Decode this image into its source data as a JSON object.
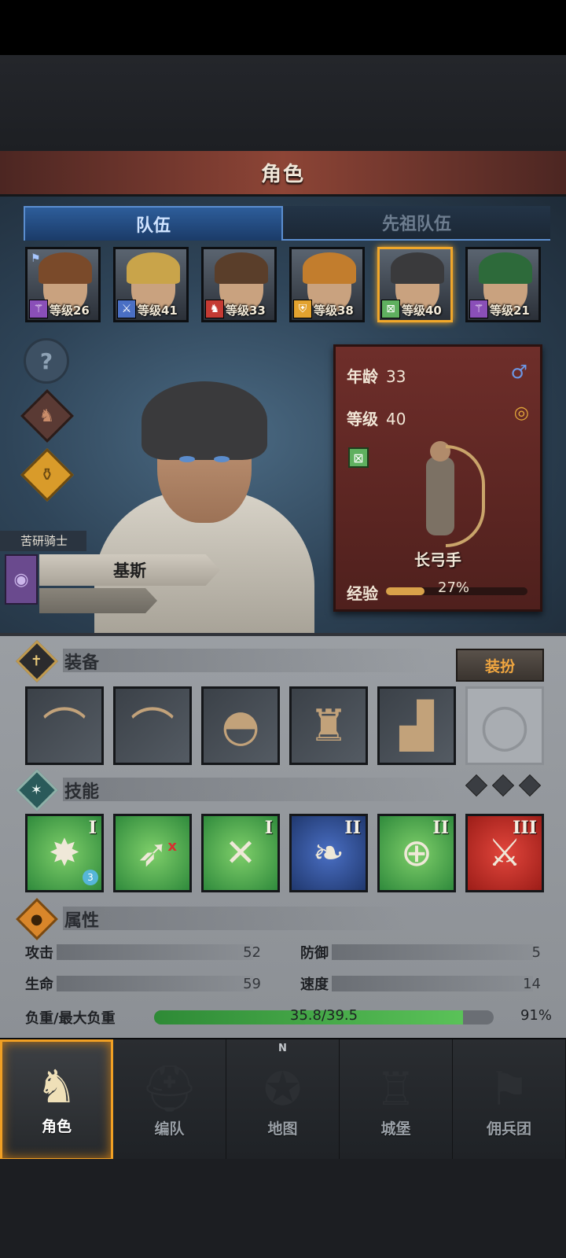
{
  "header": {
    "title": "角色"
  },
  "tabs": [
    {
      "label": "队伍",
      "active": true
    },
    {
      "label": "先祖队伍",
      "active": false
    }
  ],
  "party": [
    {
      "level": "等级26",
      "badge_icon": "staff-icon",
      "badge_color": "#8a4fb8",
      "hair_color": "#7a4a2a",
      "flag": true,
      "selected": false
    },
    {
      "level": "等级41",
      "badge_icon": "sword-icon",
      "badge_color": "#4a6fc4",
      "hair_color": "#c9a44a",
      "flag": false,
      "selected": false
    },
    {
      "level": "等级33",
      "badge_icon": "horse-icon",
      "badge_color": "#c43a33",
      "hair_color": "#5a3e2a",
      "flag": false,
      "selected": false
    },
    {
      "level": "等级38",
      "badge_icon": "shield-icon",
      "badge_color": "#e2a22f",
      "hair_color": "#c27d2d",
      "flag": false,
      "selected": false
    },
    {
      "level": "等级40",
      "badge_icon": "arrows-icon",
      "badge_color": "#5fb05f",
      "hair_color": "#3a3a3c",
      "flag": false,
      "selected": true
    },
    {
      "level": "等级21",
      "badge_icon": "staff-icon",
      "badge_color": "#8a4fb8",
      "hair_color": "#2d6a3a",
      "flag": false,
      "selected": false
    }
  ],
  "character": {
    "title": "苦研骑士",
    "name": "基斯",
    "age_label": "年龄",
    "age": "33",
    "level_label": "等级",
    "level": "40",
    "class_name": "长弓手",
    "exp_label": "经验",
    "exp_percent": "27%",
    "exp_fraction": 0.27
  },
  "equipment": {
    "title": "装备",
    "dress_button": "装扮",
    "slots": [
      {
        "name": "longbow",
        "icon": "bow-icon",
        "empty": false
      },
      {
        "name": "longbow-2",
        "icon": "bow-icon",
        "empty": false
      },
      {
        "name": "hood",
        "icon": "hood-icon",
        "empty": false
      },
      {
        "name": "tunic",
        "icon": "tunic-icon",
        "empty": false
      },
      {
        "name": "boots",
        "icon": "boots-icon",
        "empty": false
      },
      {
        "name": "ring",
        "icon": "ring-icon",
        "empty": true
      }
    ]
  },
  "skills": {
    "title": "技能",
    "items": [
      {
        "rank": "I",
        "color": "green",
        "icon": "burst-sword-icon",
        "pip": "3",
        "mark": ""
      },
      {
        "rank": "",
        "color": "green",
        "icon": "bird-bow-icon",
        "pip": "",
        "mark": "x"
      },
      {
        "rank": "I",
        "color": "green",
        "icon": "crossed-bow-sword-icon",
        "pip": "",
        "mark": ""
      },
      {
        "rank": "II",
        "color": "blue",
        "icon": "wind-icon",
        "pip": "",
        "mark": ""
      },
      {
        "rank": "II",
        "color": "green",
        "icon": "crosshair-icon",
        "pip": "",
        "mark": ""
      },
      {
        "rank": "III",
        "color": "red",
        "icon": "sword-icon",
        "pip": "",
        "mark": ""
      }
    ]
  },
  "attributes": {
    "title": "属性",
    "attack_label": "攻击",
    "attack": "52",
    "defense_label": "防御",
    "defense": "5",
    "hp_label": "生命",
    "hp": "59",
    "speed_label": "速度",
    "speed": "14",
    "load_label": "负重/最大负重",
    "load_value": "35.8/39.5",
    "load_percent": "91%",
    "load_fraction": 0.91
  },
  "nav": [
    {
      "label": "角色",
      "icon": "knight-icon",
      "active": true
    },
    {
      "label": "编队",
      "icon": "helmet-icon",
      "active": false
    },
    {
      "label": "地图",
      "icon": "compass-icon",
      "active": false
    },
    {
      "label": "城堡",
      "icon": "castle-icon",
      "active": false
    },
    {
      "label": "佣兵团",
      "icon": "banner-icon",
      "active": false
    }
  ],
  "compass_letter": "N"
}
